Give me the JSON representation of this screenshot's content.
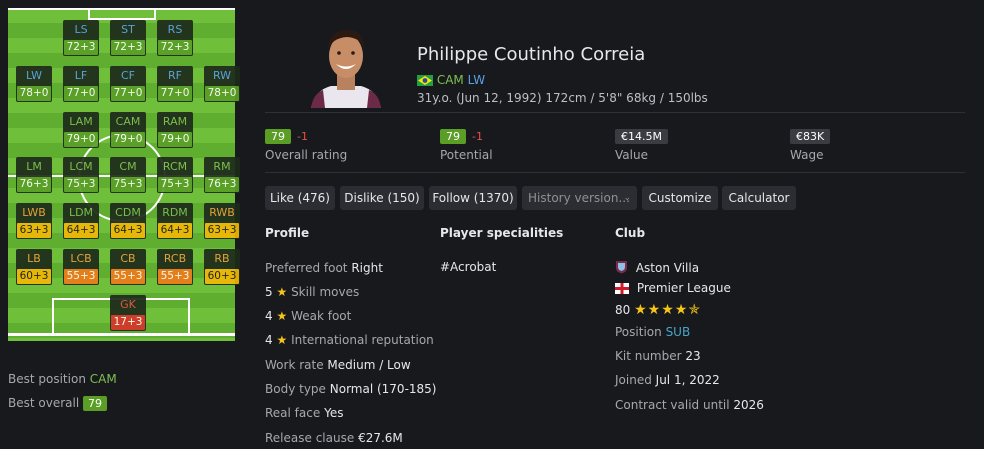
{
  "positions": [
    {
      "name": "LS",
      "rating": "72+3",
      "name_color": "blue",
      "rating_color": "green"
    },
    {
      "name": "ST",
      "rating": "72+3",
      "name_color": "blue",
      "rating_color": "green"
    },
    {
      "name": "RS",
      "rating": "72+3",
      "name_color": "blue",
      "rating_color": "green"
    },
    {
      "name": "LW",
      "rating": "78+0",
      "name_color": "blue",
      "rating_color": "green"
    },
    {
      "name": "LF",
      "rating": "77+0",
      "name_color": "blue",
      "rating_color": "green"
    },
    {
      "name": "CF",
      "rating": "77+0",
      "name_color": "blue",
      "rating_color": "green"
    },
    {
      "name": "RF",
      "rating": "77+0",
      "name_color": "blue",
      "rating_color": "green"
    },
    {
      "name": "RW",
      "rating": "78+0",
      "name_color": "blue",
      "rating_color": "green"
    },
    {
      "name": "LAM",
      "rating": "79+0",
      "name_color": "green",
      "rating_color": "green"
    },
    {
      "name": "CAM",
      "rating": "79+0",
      "name_color": "green",
      "rating_color": "green"
    },
    {
      "name": "RAM",
      "rating": "79+0",
      "name_color": "green",
      "rating_color": "green"
    },
    {
      "name": "LM",
      "rating": "76+3",
      "name_color": "green",
      "rating_color": "green"
    },
    {
      "name": "LCM",
      "rating": "75+3",
      "name_color": "green",
      "rating_color": "green"
    },
    {
      "name": "CM",
      "rating": "75+3",
      "name_color": "green",
      "rating_color": "green"
    },
    {
      "name": "RCM",
      "rating": "75+3",
      "name_color": "green",
      "rating_color": "green"
    },
    {
      "name": "RM",
      "rating": "76+3",
      "name_color": "green",
      "rating_color": "green"
    },
    {
      "name": "LWB",
      "rating": "63+3",
      "name_color": "orange",
      "rating_color": "yellow"
    },
    {
      "name": "LDM",
      "rating": "64+3",
      "name_color": "green",
      "rating_color": "yellow"
    },
    {
      "name": "CDM",
      "rating": "64+3",
      "name_color": "green",
      "rating_color": "yellow"
    },
    {
      "name": "RDM",
      "rating": "64+3",
      "name_color": "green",
      "rating_color": "yellow"
    },
    {
      "name": "RWB",
      "rating": "63+3",
      "name_color": "orange",
      "rating_color": "yellow"
    },
    {
      "name": "LB",
      "rating": "60+3",
      "name_color": "orange",
      "rating_color": "yellow"
    },
    {
      "name": "LCB",
      "rating": "55+3",
      "name_color": "orange",
      "rating_color": "orange"
    },
    {
      "name": "CB",
      "rating": "55+3",
      "name_color": "orange",
      "rating_color": "orange"
    },
    {
      "name": "RCB",
      "rating": "55+3",
      "name_color": "orange",
      "rating_color": "orange"
    },
    {
      "name": "RB",
      "rating": "60+3",
      "name_color": "orange",
      "rating_color": "yellow"
    },
    {
      "name": "GK",
      "rating": "17+3",
      "name_color": "red",
      "rating_color": "red"
    }
  ],
  "best": {
    "position_label": "Best position",
    "position_value": "CAM",
    "overall_label": "Best overall",
    "overall_value": "79"
  },
  "player": {
    "name": "Philippe Coutinho Correia",
    "pos1": "CAM",
    "pos2": "LW",
    "meta": "31y.o. (Jun 12, 1992) 172cm / 5'8\" 68kg / 150lbs"
  },
  "stats": [
    {
      "value": "79",
      "diff": "-1",
      "label": "Overall rating"
    },
    {
      "value": "79",
      "diff": "-1",
      "label": "Potential"
    },
    {
      "value": "€14.5M",
      "diff": "",
      "label": "Value"
    },
    {
      "value": "€83K",
      "diff": "",
      "label": "Wage"
    }
  ],
  "buttons": {
    "like": "Like (476)",
    "dislike": "Dislike (150)",
    "follow": "Follow (1370)",
    "history": "History version...",
    "customize": "Customize",
    "calculator": "Calculator"
  },
  "profile": {
    "title": "Profile",
    "foot_label": "Preferred foot",
    "foot_value": "Right",
    "skill_num": "5",
    "skill_label": "Skill moves",
    "weak_num": "4",
    "weak_label": "Weak foot",
    "rep_num": "4",
    "rep_label": "International reputation",
    "work_label": "Work rate",
    "work_value": "Medium / Low",
    "body_label": "Body type",
    "body_value": "Normal (170-185)",
    "face_label": "Real face",
    "face_value": "Yes",
    "release_label": "Release clause",
    "release_value": "€27.6M"
  },
  "specialities": {
    "title": "Player specialities",
    "items": [
      "#Acrobat"
    ]
  },
  "club": {
    "title": "Club",
    "name": "Aston Villa",
    "league": "Premier League",
    "rating": "80",
    "position_label": "Position",
    "position_value": "SUB",
    "kit_label": "Kit number",
    "kit_value": "23",
    "joined_label": "Joined",
    "joined_value": "Jul 1, 2022",
    "contract_label": "Contract valid until",
    "contract_value": "2026"
  }
}
